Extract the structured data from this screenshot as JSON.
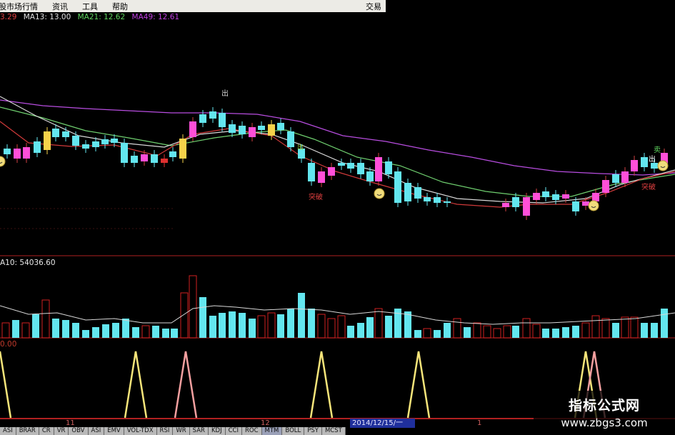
{
  "menu": {
    "items": [
      "股市场行情",
      "资讯",
      "工具",
      "帮助"
    ],
    "right_label": "交易"
  },
  "ma_legend": [
    {
      "text": "3.29",
      "color": "#e04040"
    },
    {
      "text": "MA13: 13.00",
      "color": "#e0e0e0"
    },
    {
      "text": "MA21: 12.62",
      "color": "#5fd35f"
    },
    {
      "text": "MA49: 12.61",
      "color": "#c040e0"
    }
  ],
  "volume_legend": "A10: 54036.60",
  "indicator_legend": "0.00",
  "signals": {
    "out": "出",
    "out2": "出",
    "sell": "卖",
    "breakout": "突破",
    "breakout2": "突破"
  },
  "x_axis": {
    "ticks": [
      "11",
      "12",
      "1"
    ],
    "cursor_date": "2014/12/15/一"
  },
  "tabs": [
    "ASI",
    "BRAR",
    "CR",
    "VR",
    "OBV",
    "ASI",
    "EMV",
    "VOL-TDX",
    "RSI",
    "WR",
    "SAR",
    "KDJ",
    "CCI",
    "ROC",
    "MTM",
    "BOLL",
    "PSY",
    "MCST"
  ],
  "active_tab": "MTM",
  "watermark": {
    "title": "指标公式网",
    "url": "www.zbgs3.com"
  },
  "colors": {
    "up": "#ff4fd8",
    "down": "#63e6ef",
    "yellow_up": "#f6d24a",
    "vol_up": "#d02020",
    "vol_down": "#63e6ef",
    "ma13": "#d8d8d8",
    "ma21": "#6fcf6f",
    "ma49": "#b84de0",
    "ma5": "#d03a3a",
    "peak_yellow": "#f6e57a",
    "peak_pink": "#f4a0a0"
  }
}
